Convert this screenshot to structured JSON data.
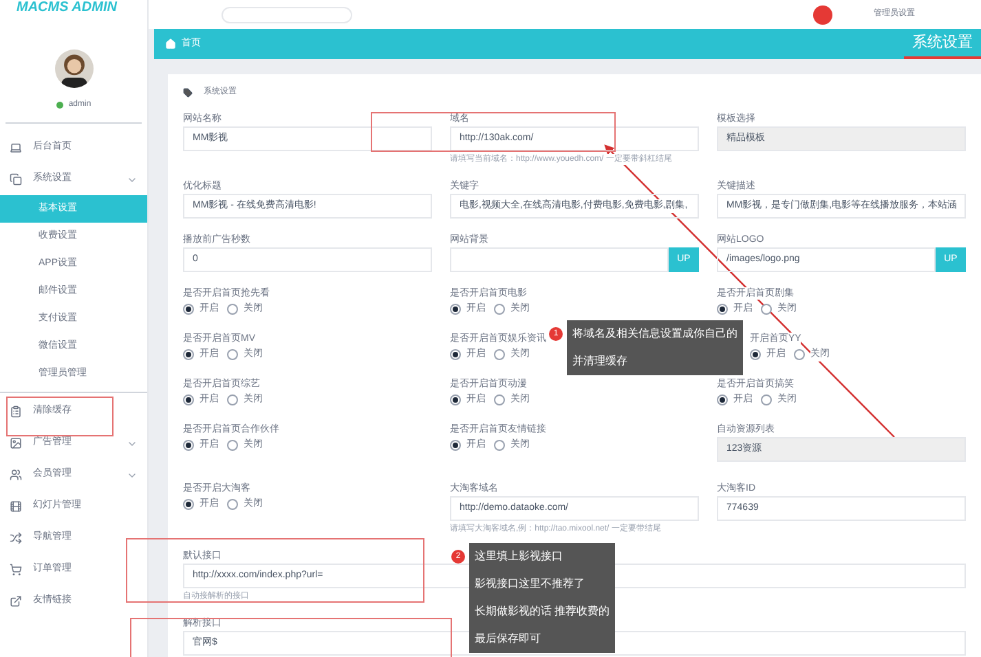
{
  "header": {
    "logo": "MACMS ADMIN",
    "admin_label": "管理员设置"
  },
  "title_bar": {
    "home": "首页",
    "title": "系统设置"
  },
  "sidebar": {
    "user": {
      "name": "admin",
      "online": true
    },
    "items": [
      {
        "label": "后台首页",
        "kind": "link",
        "selected": false
      },
      {
        "label": "系统设置",
        "kind": "group",
        "selected": false,
        "children": [
          {
            "label": "基本设置",
            "selected": true
          },
          {
            "label": "收费设置",
            "selected": false
          },
          {
            "label": "APP设置",
            "selected": false
          },
          {
            "label": "邮件设置",
            "selected": false
          },
          {
            "label": "支付设置",
            "selected": false
          },
          {
            "label": "微信设置",
            "selected": false
          },
          {
            "label": "管理员管理",
            "selected": false
          }
        ]
      },
      {
        "label": "清除缓存",
        "kind": "link",
        "selected": false
      },
      {
        "label": "广告管理",
        "kind": "group",
        "selected": false
      },
      {
        "label": "会员管理",
        "kind": "group",
        "selected": false
      },
      {
        "label": "幻灯片管理",
        "kind": "link",
        "selected": false
      },
      {
        "label": "导航管理",
        "kind": "link",
        "selected": false
      },
      {
        "label": "订单管理",
        "kind": "link",
        "selected": false
      },
      {
        "label": "友情链接",
        "kind": "link",
        "selected": false
      }
    ]
  },
  "form": {
    "section": "系统设置",
    "rows": [
      [
        {
          "kind": "text",
          "label": "网站名称",
          "value": "MM影视"
        },
        {
          "kind": "text",
          "label": "域名",
          "value": "http://130ak.com/",
          "hint": "请填写当前域名：http://www.youedh.com/ 一定要带斜杠结尾"
        },
        {
          "kind": "readonly",
          "label": "模板选择",
          "value": "精品模板"
        }
      ],
      [
        {
          "kind": "text",
          "label": "优化标题",
          "value": "MM影视 - 在线免费高清电影!"
        },
        {
          "kind": "text",
          "label": "关键字",
          "value": "电影,视频大全,在线高清电影,付费电影,免费电影,剧集,"
        },
        {
          "kind": "text",
          "label": "关键描述",
          "value": "MM影视，是专门做剧集,电影等在线播放服务，本站涵"
        }
      ],
      [
        {
          "kind": "text",
          "label": "播放前广告秒数",
          "value": "0"
        },
        {
          "kind": "upload",
          "label": "网站背景",
          "button": "UP"
        },
        {
          "kind": "upload",
          "label": "网站LOGO",
          "value": "/images/logo.png",
          "button": "UP"
        }
      ],
      [
        {
          "kind": "radio",
          "label": "是否开启首页抢先看",
          "options": [
            {
              "label": "开启",
              "selected": true
            },
            {
              "label": "关闭",
              "selected": false
            }
          ]
        },
        {
          "kind": "radio",
          "label": "是否开启首页电影",
          "options": [
            {
              "label": "开启",
              "selected": true
            },
            {
              "label": "关闭",
              "selected": false
            }
          ]
        },
        {
          "kind": "radio",
          "label": "是否开启首页剧集",
          "options": [
            {
              "label": "开启",
              "selected": true
            },
            {
              "label": "关闭",
              "selected": false
            }
          ]
        }
      ],
      [
        {
          "kind": "radio",
          "label": "是否开启首页MV",
          "options": [
            {
              "label": "开启",
              "selected": true
            },
            {
              "label": "关闭",
              "selected": false
            }
          ]
        },
        {
          "kind": "radio",
          "label": "是否开启首页娱乐资讯",
          "options": [
            {
              "label": "开启",
              "selected": true
            },
            {
              "label": "关闭",
              "selected": false
            }
          ]
        },
        {
          "kind": "radio",
          "label": "开启首页YY",
          "options": [
            {
              "label": "开启",
              "selected": true
            },
            {
              "label": "关闭",
              "selected": false
            }
          ]
        }
      ],
      [
        {
          "kind": "radio",
          "label": "是否开启首页综艺",
          "options": [
            {
              "label": "开启",
              "selected": true
            },
            {
              "label": "关闭",
              "selected": false
            }
          ]
        },
        {
          "kind": "radio",
          "label": "是否开启首页动漫",
          "options": [
            {
              "label": "开启",
              "selected": true
            },
            {
              "label": "关闭",
              "selected": false
            }
          ]
        },
        {
          "kind": "radio",
          "label": "是否开启首页搞笑",
          "options": [
            {
              "label": "开启",
              "selected": true
            },
            {
              "label": "关闭",
              "selected": false
            }
          ]
        }
      ],
      [
        {
          "kind": "radio",
          "label": "是否开启首页合作伙伴",
          "options": [
            {
              "label": "开启",
              "selected": true
            },
            {
              "label": "关闭",
              "selected": false
            }
          ]
        },
        {
          "kind": "radio",
          "label": "是否开启首页友情链接",
          "options": [
            {
              "label": "开启",
              "selected": true
            },
            {
              "label": "关闭",
              "selected": false
            }
          ]
        },
        {
          "kind": "readonly",
          "label": "自动资源列表",
          "value": "123资源"
        }
      ],
      [
        {
          "kind": "radio",
          "label": "是否开启大淘客",
          "options": [
            {
              "label": "开启",
              "selected": true
            },
            {
              "label": "关闭",
              "selected": false
            }
          ]
        },
        {
          "kind": "text",
          "label": "大淘客域名",
          "value": "http://demo.dataoke.com/",
          "hint": "请填写大淘客域名,例：http://tao.mixool.net/ 一定要带结尾"
        },
        {
          "kind": "text",
          "label": "大淘客ID",
          "value": "774639"
        }
      ],
      [
        {
          "kind": "wide",
          "label": "默认接口",
          "value": "http://xxxx.com/index.php?url=",
          "hint": "自动接解析的接口"
        }
      ],
      [
        {
          "kind": "wide",
          "label": "解析接口",
          "value": "官网$"
        }
      ]
    ]
  },
  "callouts": [
    {
      "number": "1",
      "lines": [
        "将域名及相关信息设置成你自己的",
        "并清理缓存"
      ]
    },
    {
      "number": "2",
      "lines": [
        "这里填上影视接口",
        "影视接口这里不推荐了",
        "长期做影视的话 推荐收费的",
        "最后保存即可"
      ]
    }
  ]
}
